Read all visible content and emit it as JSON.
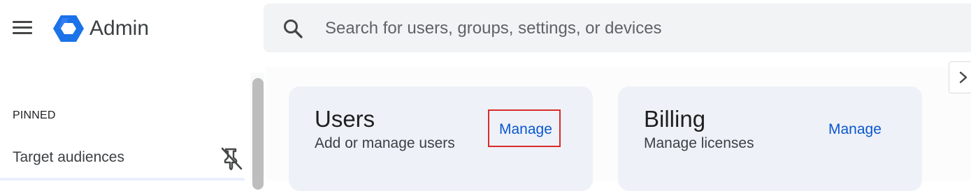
{
  "header": {
    "app_title": "Admin",
    "menu_icon": "hamburger-menu-icon",
    "logo_icon": "admin-logo-icon",
    "search": {
      "icon": "search-icon",
      "placeholder": "Search for users, groups, settings, or devices",
      "value": ""
    }
  },
  "sidebar": {
    "section_label": "PINNED",
    "items": [
      {
        "label": "Target audiences",
        "icon": "unpin-icon"
      }
    ]
  },
  "cards": [
    {
      "title": "Users",
      "subtitle": "Add or manage users",
      "action": "Manage",
      "highlighted": true
    },
    {
      "title": "Billing",
      "subtitle": "Manage licenses",
      "action": "Manage",
      "highlighted": false
    }
  ],
  "collapse_panel": {
    "icon": "chevron-right-icon"
  },
  "colors": {
    "accent_link": "#0b57d0",
    "logo_blue": "#1a73e8",
    "highlight_outline": "#d92b2b",
    "card_background": "#eef1f7",
    "search_background": "#f1f3f4"
  }
}
